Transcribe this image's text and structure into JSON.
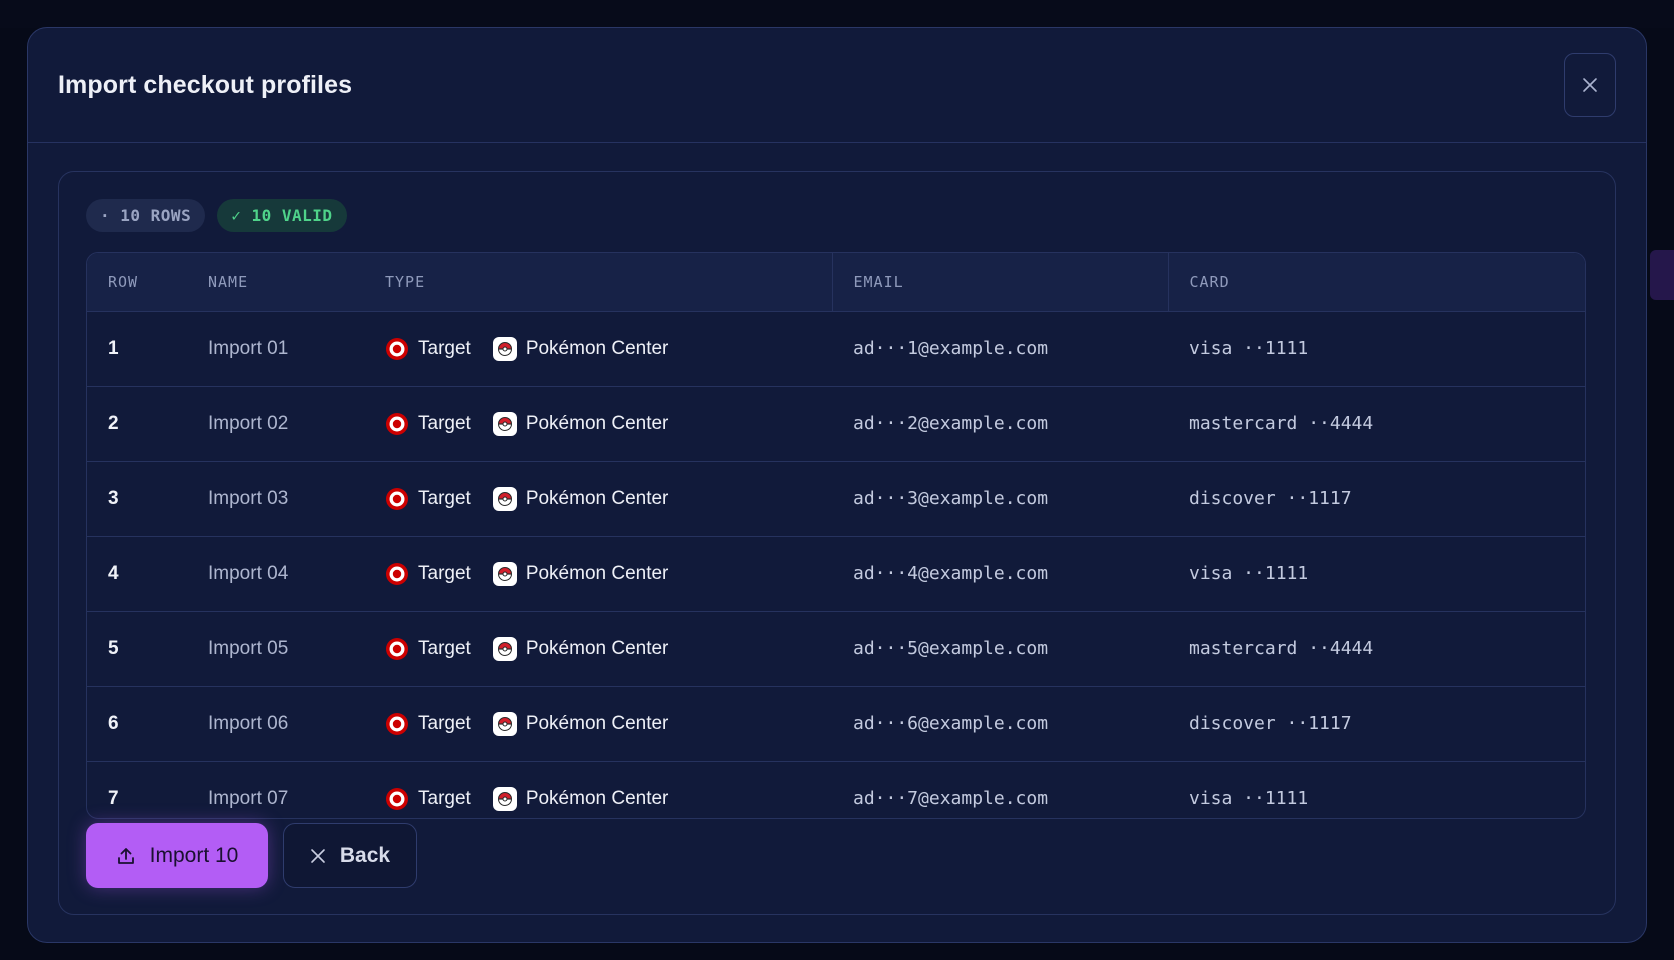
{
  "modal": {
    "title": "Import checkout profiles"
  },
  "badges": {
    "rows": "· 10 ROWS",
    "valid": "✓ 10 VALID"
  },
  "table": {
    "columns": [
      "ROW",
      "NAME",
      "TYPE",
      "EMAIL",
      "CARD"
    ],
    "rows": [
      {
        "row": "1",
        "name": "Import 01",
        "types": [
          "Target",
          "Pokémon Center"
        ],
        "email": "ad···1@example.com",
        "card": "visa ··1111"
      },
      {
        "row": "2",
        "name": "Import 02",
        "types": [
          "Target",
          "Pokémon Center"
        ],
        "email": "ad···2@example.com",
        "card": "mastercard ··4444"
      },
      {
        "row": "3",
        "name": "Import 03",
        "types": [
          "Target",
          "Pokémon Center"
        ],
        "email": "ad···3@example.com",
        "card": "discover ··1117"
      },
      {
        "row": "4",
        "name": "Import 04",
        "types": [
          "Target",
          "Pokémon Center"
        ],
        "email": "ad···4@example.com",
        "card": "visa ··1111"
      },
      {
        "row": "5",
        "name": "Import 05",
        "types": [
          "Target",
          "Pokémon Center"
        ],
        "email": "ad···5@example.com",
        "card": "mastercard ··4444"
      },
      {
        "row": "6",
        "name": "Import 06",
        "types": [
          "Target",
          "Pokémon Center"
        ],
        "email": "ad···6@example.com",
        "card": "discover ··1117"
      },
      {
        "row": "7",
        "name": "Import 07",
        "types": [
          "Target",
          "Pokémon Center"
        ],
        "email": "ad···7@example.com",
        "card": "visa ··1111"
      }
    ]
  },
  "actions": {
    "import_label": "Import 10",
    "back_label": "Back"
  },
  "colors": {
    "accent": "#b35df5",
    "valid_green": "#4fd38a",
    "target_red": "#cc0000",
    "modal_bg": "#111a3a"
  },
  "icons": {
    "close": "close-icon",
    "upload": "upload-icon",
    "back": "x-icon",
    "target": "target-logo-icon",
    "pokemon": "pokeball-icon"
  }
}
